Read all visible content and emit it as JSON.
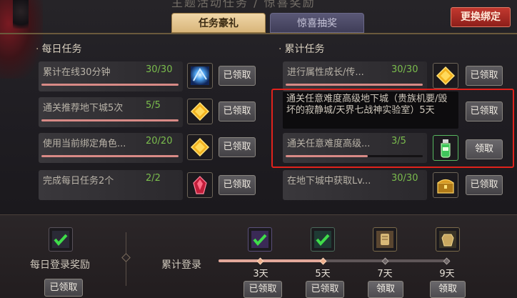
{
  "top_title": "主题活动任务 / 惊喜奖励",
  "tabs": [
    {
      "label": "任务豪礼",
      "active": true
    },
    {
      "label": "惊喜抽奖",
      "active": false
    }
  ],
  "rebind_button": "更换绑定",
  "daily": {
    "title": "每日任务",
    "tasks": [
      {
        "name": "累计在线30分钟",
        "count": "30/30",
        "progress": 1.0,
        "icon": "blue-crystal-icon",
        "button": "已领取"
      },
      {
        "name": "通关推荐地下城5次",
        "count": "5/5",
        "progress": 1.0,
        "icon": "gold-gem-icon",
        "button": "已领取"
      },
      {
        "name": "使用当前绑定角色...",
        "count": "20/20",
        "progress": 1.0,
        "icon": "gold-gem-icon",
        "button": "已领取"
      },
      {
        "name": "完成每日任务2个",
        "count": "2/2",
        "progress": 1.0,
        "icon": "red-crystal-icon",
        "button": "已领取"
      }
    ]
  },
  "cumulative": {
    "title": "累计任务",
    "tasks": [
      {
        "name": "进行属性成长/传...",
        "count": "30/30",
        "progress": 1.0,
        "icon": "gold-gem-icon",
        "button": "已领取"
      },
      {
        "name": "通关任意难度高级地下城（贵族机要/毁坏的寂静城/天界七战神实验室）5天",
        "count": "",
        "progress": 1.0,
        "icon": "",
        "button": "已领取"
      },
      {
        "name": "通关任意难度高级...",
        "count": "3/5",
        "progress": 0.6,
        "icon": "green-potion-icon",
        "button": "领取"
      },
      {
        "name": "在地下城中获取Lv...",
        "count": "30/30",
        "progress": 1.0,
        "icon": "gold-chest-icon",
        "button": "已领取"
      }
    ]
  },
  "login": {
    "daily_label": "每日登录奖励",
    "daily_button": "已领取",
    "cumulative_label": "累计登录",
    "progress": 0.46,
    "milestones": [
      {
        "day": "3天",
        "button": "已领取",
        "done": true
      },
      {
        "day": "5天",
        "button": "已领取",
        "done": true
      },
      {
        "day": "7天",
        "button": "领取",
        "done": false
      },
      {
        "day": "9天",
        "button": "领取",
        "done": false
      }
    ]
  },
  "colors": {
    "accent_red": "#e0221c",
    "complete_green": "#7bbd4d",
    "progress_fill": "#d88a86"
  }
}
